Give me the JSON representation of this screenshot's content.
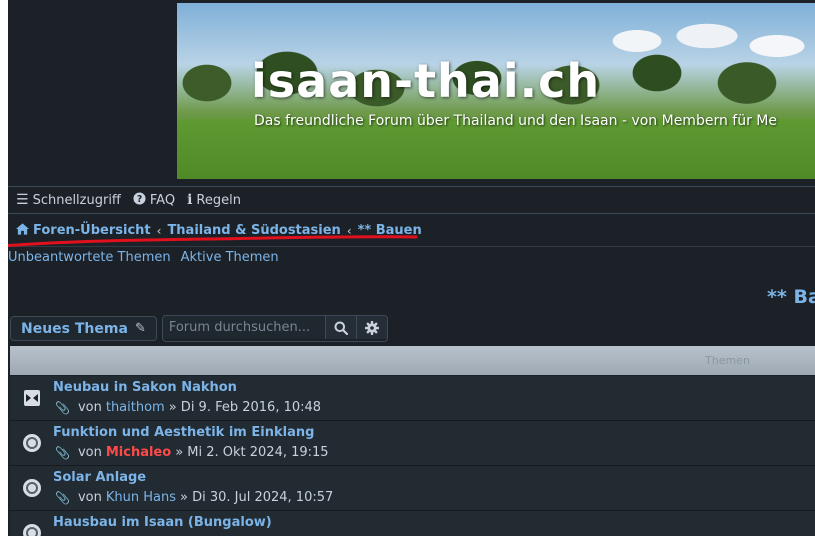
{
  "header": {
    "site_title": "isaan-thai.ch",
    "site_description": "Das freundliche Forum über Thailand und den Isaan - von Membern für Me"
  },
  "navbar": {
    "items": [
      {
        "label": "Schnellzugriff",
        "icon": "hamburger-icon"
      },
      {
        "label": "FAQ",
        "icon": "question-icon"
      },
      {
        "label": "Regeln",
        "icon": "info-icon"
      }
    ]
  },
  "breadcrumbs": {
    "items": [
      {
        "label": "Foren-Übersicht",
        "icon": "home-icon"
      },
      {
        "label": "Thailand & Südostasien"
      },
      {
        "label": "** Bauen"
      }
    ],
    "underline_color": "#e0101c"
  },
  "quick_links": [
    "Unbeantwortete Themen",
    "Aktive Themen"
  ],
  "forum_heading": "** Ba",
  "actions": {
    "new_topic_label": "Neues Thema",
    "search_placeholder": "Forum durchsuchen..."
  },
  "topic_list": {
    "column_label": "Themen",
    "topics": [
      {
        "title": "Neubau in Sakon Nakhon",
        "by": "von",
        "author": "thaithom",
        "author_highlight": false,
        "date": "» Di 9. Feb 2016, 10:48"
      },
      {
        "title": "Funktion und Aesthetik im Einklang",
        "by": "von",
        "author": "Michaleo",
        "author_highlight": true,
        "date": "» Mi 2. Okt 2024, 19:15"
      },
      {
        "title": "Solar Anlage",
        "by": "von",
        "author": "Khun Hans",
        "author_highlight": false,
        "date": "» Di 30. Jul 2024, 10:57"
      },
      {
        "title": "Hausbau im Isaan (Bungalow)",
        "by": "",
        "author": "",
        "author_highlight": false,
        "date": ""
      }
    ]
  },
  "colors": {
    "background": "#1b2127",
    "link": "#7cb4e8",
    "highlight_user": "#ff4a4a"
  }
}
